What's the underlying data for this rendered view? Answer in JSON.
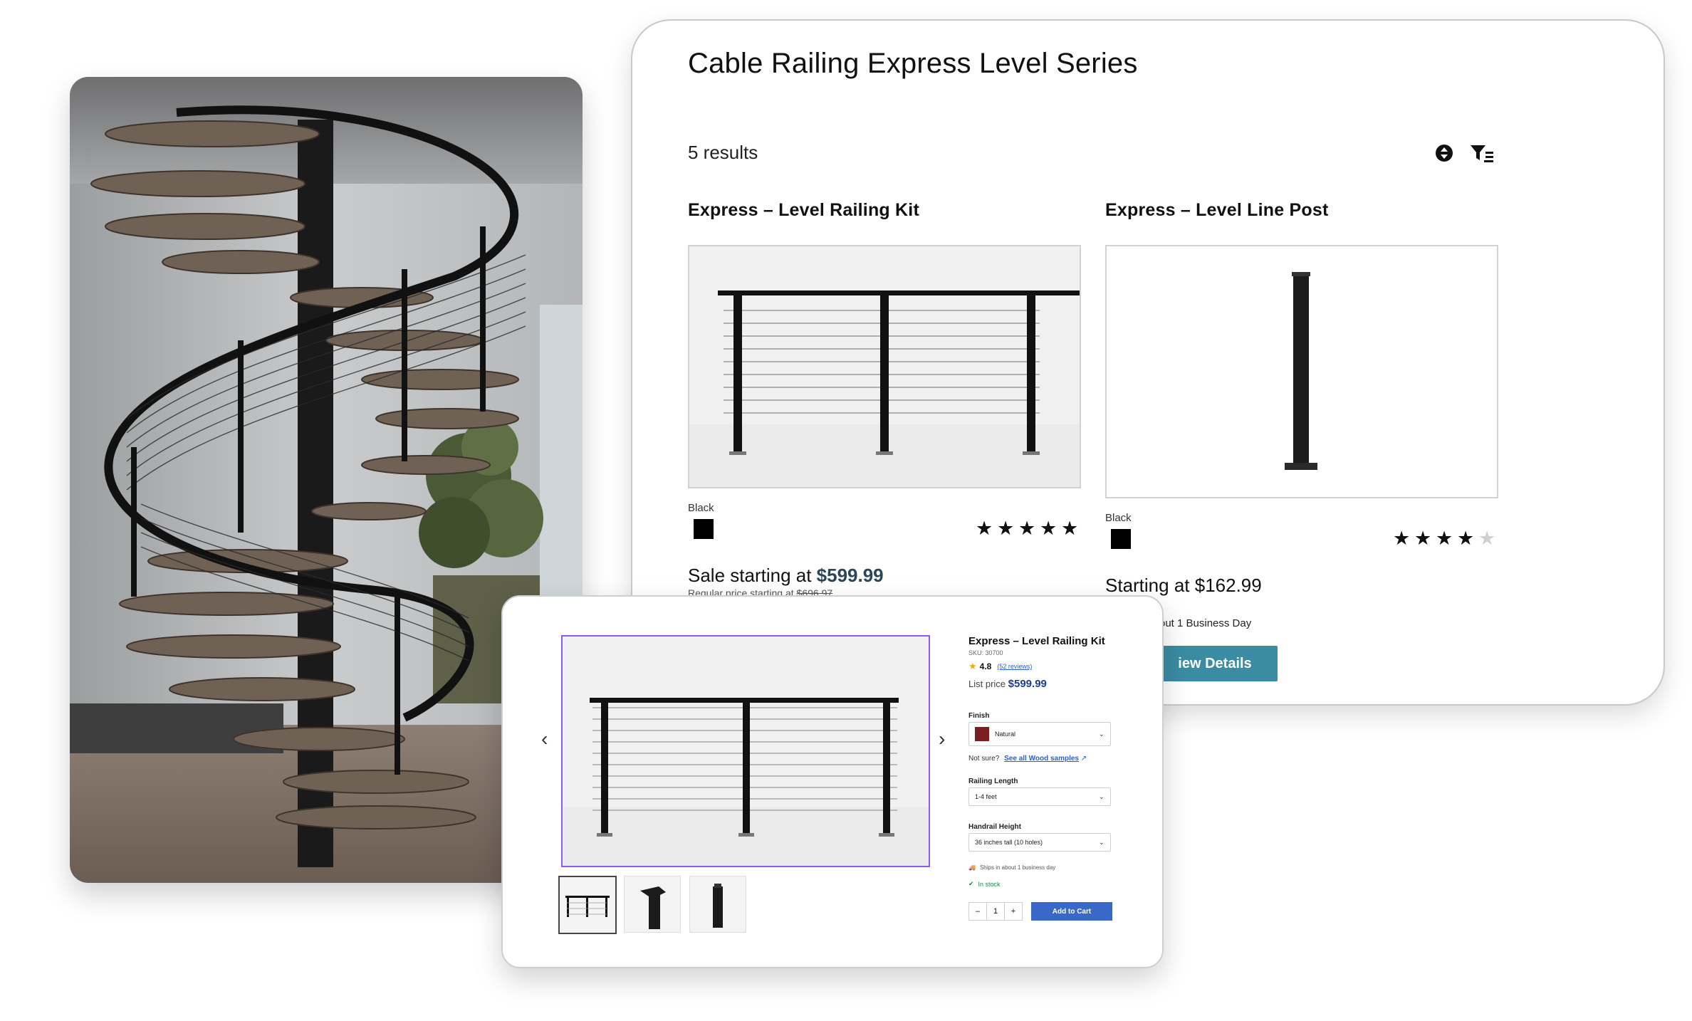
{
  "catalog": {
    "title": "Cable Railing Express Level Series",
    "results": "5 results",
    "icons": [
      "sort-icon",
      "filter-icon"
    ],
    "products": [
      {
        "name": "Express – Level Railing Kit",
        "finish_label": "Black",
        "swatch_color": "#000000",
        "rating_stars": 5,
        "price_prefix": "Sale starting at ",
        "price": "$599.99",
        "regular_price_prefix": "Regular price starting at ",
        "regular_price": "$696.97"
      },
      {
        "name": "Express – Level Line Post",
        "finish_label": "Black",
        "swatch_color": "#000000",
        "rating_stars": 4,
        "price_text": "Starting at $162.99",
        "ship_text": "out 1 Business Day",
        "button_label": "iew Details"
      }
    ]
  },
  "detail": {
    "title": "Express – Level Railing Kit",
    "sku": "SKU: 30700",
    "rating": "4.8",
    "reviews_link": "(52 reviews)",
    "list_label": "List price",
    "list_price": "$599.99",
    "finish_label": "Finish",
    "finish_value": "Natural",
    "finish_color": "#7a1f22",
    "not_sure": "Not sure?",
    "samples_link": "See all Wood samples",
    "length_label": "Railing Length",
    "length_value": "1-4 feet",
    "height_label": "Handrail Height",
    "height_value": "36 inches tall (10 holes)",
    "ships_text": "Ships in about 1 business day",
    "stock_text": "In stock",
    "qty_minus": "–",
    "qty_value": "1",
    "qty_plus": "+",
    "add_to_cart": "Add to Cart",
    "prev_arrow": "‹",
    "next_arrow": "›"
  },
  "colors": {
    "price_accent": "#2a4657",
    "button_teal": "#3b8ca3",
    "cart_blue": "#3a68c9",
    "image_border_purple": "#8a5cf0"
  }
}
